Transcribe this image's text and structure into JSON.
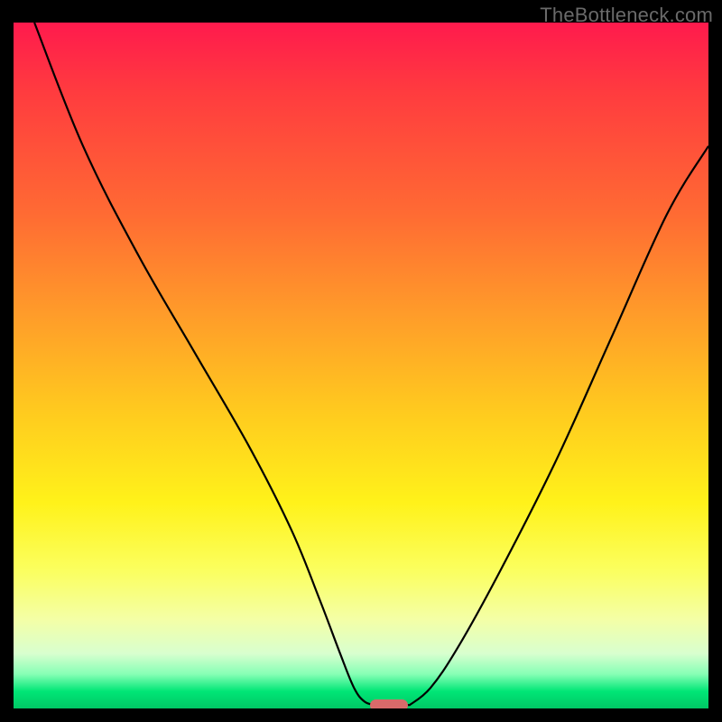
{
  "watermark": "TheBottleneck.com",
  "chart_data": {
    "type": "line",
    "title": "",
    "xlabel": "",
    "ylabel": "",
    "xlim": [
      0,
      100
    ],
    "ylim": [
      0,
      100
    ],
    "grid": false,
    "series": [
      {
        "name": "left-branch",
        "x": [
          3,
          10,
          18,
          26,
          34,
          40,
          44,
          47,
          49,
          50.5,
          52
        ],
        "y": [
          100,
          82,
          66,
          52,
          38,
          26,
          16,
          8,
          3,
          1,
          0.5
        ]
      },
      {
        "name": "right-branch",
        "x": [
          57,
          60,
          64,
          70,
          78,
          86,
          94,
          100
        ],
        "y": [
          0.5,
          3,
          9,
          20,
          36,
          54,
          72,
          82
        ]
      }
    ],
    "marker": {
      "x": 54,
      "y": 0,
      "color": "#d96a6a"
    },
    "gradient_stops": [
      {
        "pos": 0,
        "color": "#ff1a4d"
      },
      {
        "pos": 100,
        "color": "#00c765"
      }
    ]
  }
}
